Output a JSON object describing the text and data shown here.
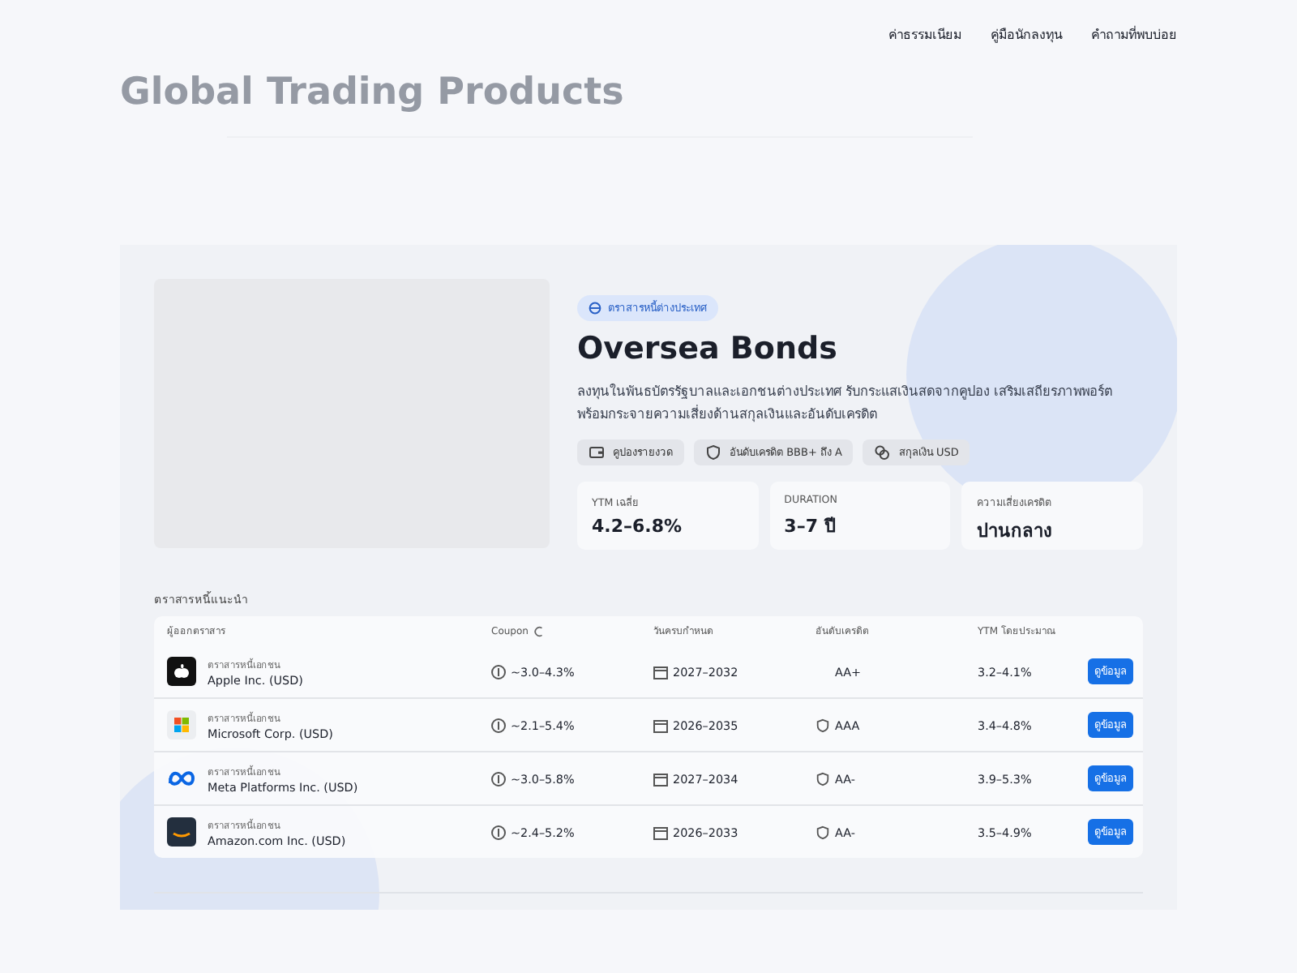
{
  "nav": [
    "ค่าธรรมเนียม",
    "คู่มือนักลงทุน",
    "คำถามที่พบบ่อย"
  ],
  "page_title": "Global Trading Products",
  "product": {
    "badge": "ตราสารหนี้ต่างประเทศ",
    "title": "Oversea Bonds",
    "description": "ลงทุนในพันธบัตรรัฐบาลและเอกชนต่างประเทศ รับกระแสเงินสดจากคูปอง เสริมเสถียรภาพพอร์ต พร้อมกระจายความเสี่ยงด้านสกุลเงินและอันดับเครดิต",
    "chips": [
      {
        "kind": "wallet",
        "label": "คูปองรายงวด"
      },
      {
        "kind": "shield",
        "label": "อันดับเครดิต BBB+ ถึง A"
      },
      {
        "kind": "coins",
        "label": "สกุลเงิน USD"
      }
    ],
    "stats": [
      {
        "label": "YTM เฉลี่ย",
        "value": "4.2–6.8%"
      },
      {
        "label": "DURATION",
        "value": "3–7 ปี"
      },
      {
        "label": "ความเสี่ยงเครดิต",
        "value": "ปานกลาง"
      }
    ]
  },
  "table": {
    "title": "ตราสารหนี้แนะนำ",
    "columns": [
      "ผู้ออกตราสาร",
      "Coupon",
      "วันครบกำหนด",
      "อันดับเครดิต",
      "YTM โดยประมาณ"
    ],
    "rows": [
      {
        "kind": "apple",
        "type": "ตราสารหนี้เอกชน",
        "issuer": "Apple Inc. (USD)",
        "coupon": "~3.0–4.3%",
        "maturity": "2027–2032",
        "rating": "AA+",
        "rating_icon": false,
        "ytm": "3.2–4.1%",
        "action": "ดูข้อมูล"
      },
      {
        "kind": "microsoft",
        "type": "ตราสารหนี้เอกชน",
        "issuer": "Microsoft Corp. (USD)",
        "coupon": "~2.1–5.4%",
        "maturity": "2026–2035",
        "rating": "AAA",
        "rating_icon": true,
        "ytm": "3.4–4.8%",
        "action": "ดูข้อมูล"
      },
      {
        "kind": "meta",
        "type": "ตราสารหนี้เอกชน",
        "issuer": "Meta Platforms Inc. (USD)",
        "coupon": "~3.0–5.8%",
        "maturity": "2027–2034",
        "rating": "AA-",
        "rating_icon": true,
        "ytm": "3.9–5.3%",
        "action": "ดูข้อมูล"
      },
      {
        "kind": "amazon",
        "type": "ตราสารหนี้เอกชน",
        "issuer": "Amazon.com Inc. (USD)",
        "coupon": "~2.4–5.2%",
        "maturity": "2026–2033",
        "rating": "AA-",
        "rating_icon": true,
        "ytm": "3.5–4.9%",
        "action": "ดูข้อมูล"
      }
    ]
  }
}
